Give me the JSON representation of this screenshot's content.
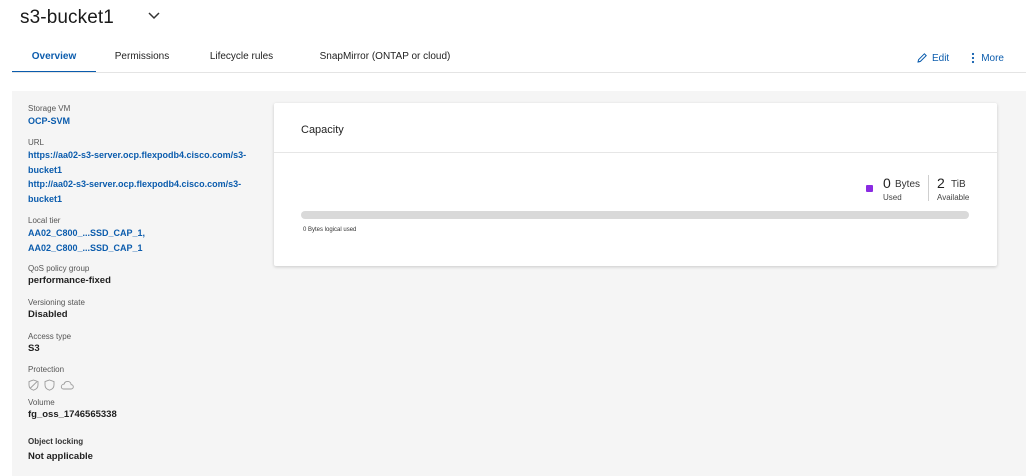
{
  "header": {
    "title": "s3-bucket1",
    "title_menu_icon": "chevron-down-icon"
  },
  "tabs": [
    {
      "label": "Overview",
      "active": true
    },
    {
      "label": "Permissions",
      "active": false
    },
    {
      "label": "Lifecycle rules",
      "active": false
    },
    {
      "label": "SnapMirror (ONTAP or cloud)",
      "active": false
    }
  ],
  "actions": {
    "edit_label": "Edit",
    "edit_icon": "pencil-icon",
    "more_label": "More",
    "more_icon": "vertical-ellipsis-icon"
  },
  "details": {
    "storage_vm": {
      "label": "Storage VM",
      "value": "OCP-SVM"
    },
    "url": {
      "label": "URL",
      "line1a": "https://aa02-s3-server.ocp.flexpodb4.cisco.com/s3-",
      "line1b": "bucket1",
      "line2a": "http://aa02-s3-server.ocp.flexpodb4.cisco.com/s3-",
      "line2b": "bucket1"
    },
    "local_tier": {
      "label": "Local tier",
      "value1": "AA02_C800_...SSD_CAP_1,",
      "value2": "AA02_C800_...SSD_CAP_1"
    },
    "qos_policy_group": {
      "label": "QoS policy group",
      "value": "performance-fixed"
    },
    "versioning_state": {
      "label": "Versioning state",
      "value": "Disabled"
    },
    "access_type": {
      "label": "Access type",
      "value": "S3"
    },
    "protection": {
      "label": "Protection",
      "icons": [
        "shield-slash-icon",
        "shield-icon",
        "cloud-icon"
      ]
    },
    "volume": {
      "label": "Volume",
      "value": "fg_oss_1746565338"
    },
    "object_locking": {
      "label": "Object locking",
      "value": "Not applicable"
    }
  },
  "capacity": {
    "title": "Capacity",
    "used_num": "0",
    "used_unit": "Bytes",
    "used_label": "Used",
    "available_num": "2",
    "available_unit": "TiB",
    "available_label": "Available",
    "used_fraction": 0,
    "logical_used_caption": "0 Bytes logical used",
    "used_color": "#8a2be2",
    "track_color": "#d9d9d9"
  },
  "colors": {
    "accent": "#0b5cad"
  }
}
